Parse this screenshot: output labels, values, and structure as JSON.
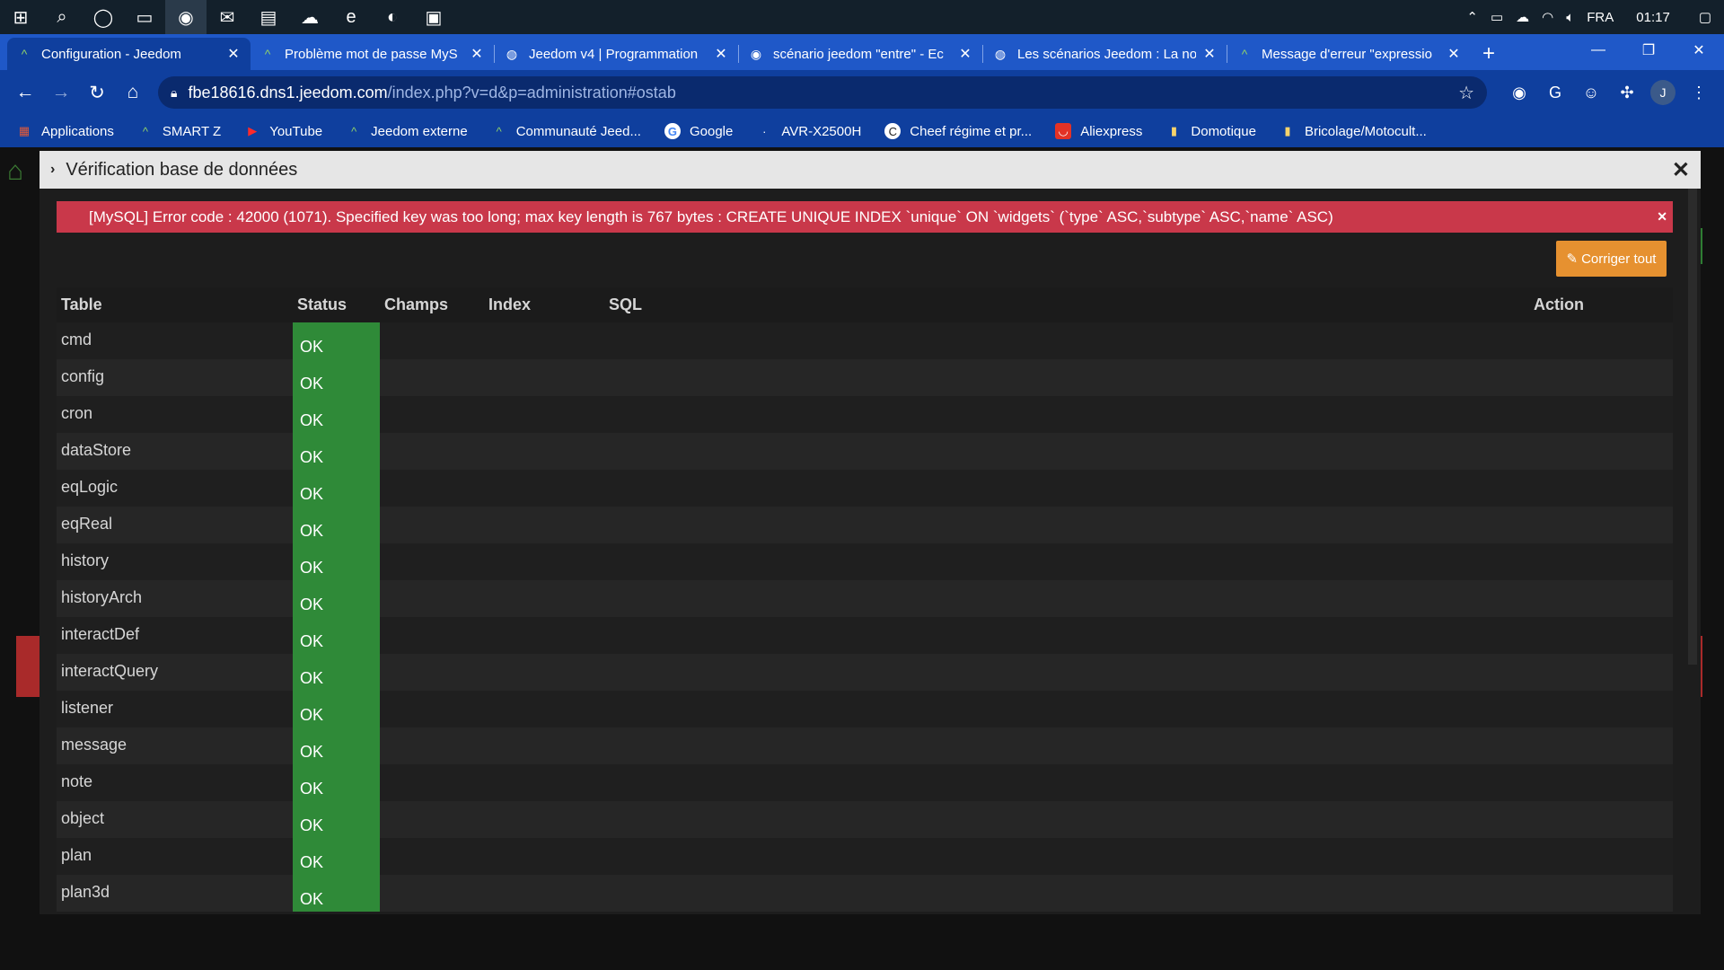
{
  "taskbar": {
    "icons": [
      "windows-logo",
      "search-icon",
      "cortana-icon",
      "task-view-icon",
      "chrome-icon",
      "mail-icon",
      "explorer-icon",
      "onedrive-icon",
      "ie-icon",
      "edge-icon",
      "photos-icon"
    ],
    "language": "FRA",
    "time": "01:17"
  },
  "tabs": [
    {
      "title": "Configuration - Jeedom",
      "active": true
    },
    {
      "title": "Problème mot de passe MyS",
      "active": false
    },
    {
      "title": "Jeedom v4 | Programmation",
      "active": false
    },
    {
      "title": "scénario jeedom \"entre\" - Ec",
      "active": false
    },
    {
      "title": "Les scénarios Jeedom : La no",
      "active": false
    },
    {
      "title": "Message d'erreur \"expressio",
      "active": false
    }
  ],
  "address": {
    "host": "fbe18616.dns1.jeedom.com",
    "path": "/index.php?v=d&p=administration#ostab",
    "profile_initial": "J"
  },
  "bookmarks": [
    {
      "label": "Applications",
      "icon": "apps-grid-icon"
    },
    {
      "label": "SMART Z",
      "icon": "jeedom-icon"
    },
    {
      "label": "YouTube",
      "icon": "youtube-icon"
    },
    {
      "label": "Jeedom externe",
      "icon": "jeedom-icon"
    },
    {
      "label": "Communauté Jeed...",
      "icon": "jeedom-icon"
    },
    {
      "label": "Google",
      "icon": "google-icon"
    },
    {
      "label": "AVR-X2500H",
      "icon": "page-icon"
    },
    {
      "label": "Cheef régime et pr...",
      "icon": "cheef-icon"
    },
    {
      "label": "Aliexpress",
      "icon": "aliexpress-icon"
    },
    {
      "label": "Domotique",
      "icon": "folder-icon"
    },
    {
      "label": "Bricolage/Motocult...",
      "icon": "folder-icon"
    }
  ],
  "modal": {
    "title": "Vérification base de données",
    "alert": "[MySQL] Error code : 42000 (1071). Specified key was too long; max key length is 767 bytes : CREATE UNIQUE INDEX `unique` ON `widgets` (`type` ASC,`subtype` ASC,`name` ASC)",
    "fix_button": "Corriger tout",
    "columns": {
      "table": "Table",
      "status": "Status",
      "champs": "Champs",
      "index": "Index",
      "sql": "SQL",
      "action": "Action"
    },
    "rows": [
      {
        "table": "cmd",
        "status": "OK"
      },
      {
        "table": "config",
        "status": "OK"
      },
      {
        "table": "cron",
        "status": "OK"
      },
      {
        "table": "dataStore",
        "status": "OK"
      },
      {
        "table": "eqLogic",
        "status": "OK"
      },
      {
        "table": "eqReal",
        "status": "OK"
      },
      {
        "table": "history",
        "status": "OK"
      },
      {
        "table": "historyArch",
        "status": "OK"
      },
      {
        "table": "interactDef",
        "status": "OK"
      },
      {
        "table": "interactQuery",
        "status": "OK"
      },
      {
        "table": "listener",
        "status": "OK"
      },
      {
        "table": "message",
        "status": "OK"
      },
      {
        "table": "note",
        "status": "OK"
      },
      {
        "table": "object",
        "status": "OK"
      },
      {
        "table": "plan",
        "status": "OK"
      },
      {
        "table": "plan3d",
        "status": "OK"
      }
    ]
  },
  "colors": {
    "accent": "#1f58c8",
    "ok": "#2f8a38",
    "error": "#c9384a",
    "warning": "#e69130"
  }
}
